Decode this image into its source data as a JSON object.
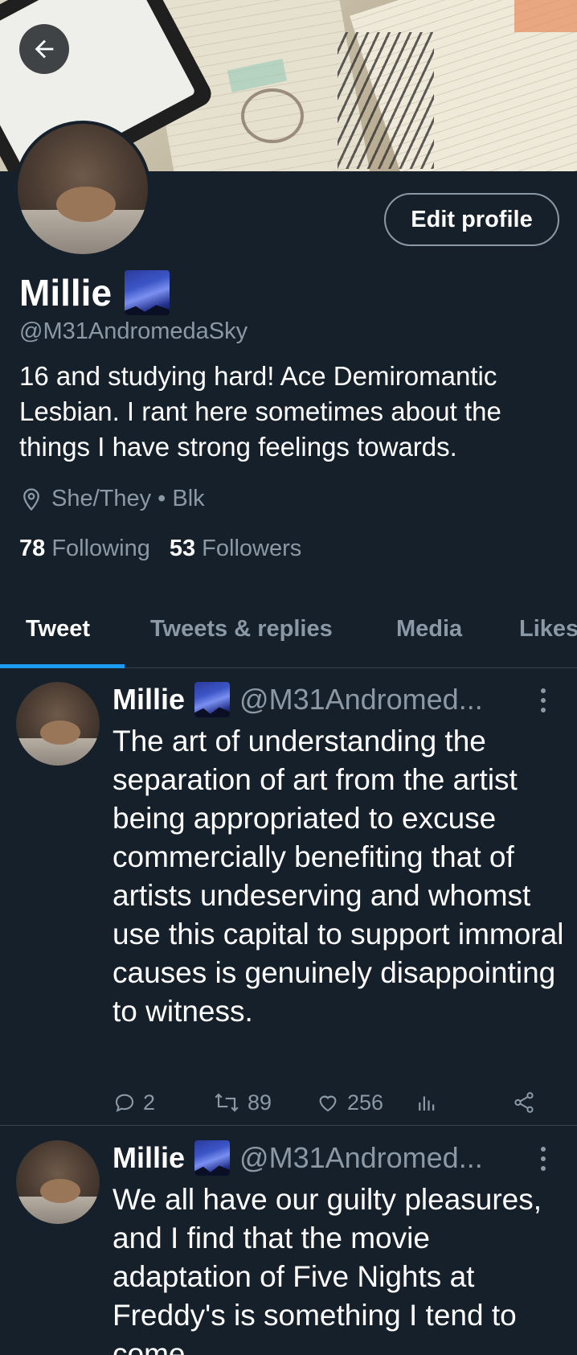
{
  "header": {
    "back_icon": "arrow-left-icon",
    "edit_profile_label": "Edit profile"
  },
  "profile": {
    "name": "Millie",
    "name_emoji": "milky-way-emoji",
    "handle": "@M31AndromedaSky",
    "bio": "16 and studying hard! Ace Demiromantic Lesbian. I rant here sometimes about the things I have strong feelings towards.",
    "location_icon": "location-pin-icon",
    "location": "She/They • Blk",
    "following_count": "78",
    "following_label": "Following",
    "followers_count": "53",
    "followers_label": "Followers"
  },
  "tabs": [
    {
      "label": "Tweet",
      "active": true
    },
    {
      "label": "Tweets & replies",
      "active": false
    },
    {
      "label": "Media",
      "active": false
    },
    {
      "label": "Likes",
      "active": false
    }
  ],
  "tweets": [
    {
      "name": "Millie",
      "handle": "@M31Andromed...",
      "text": "The art of understanding the separation of art from the artist being appropriated to excuse commercially benefiting that of artists undeserving and whomst use this capital to support immoral causes is genuinely disappointing to witness.",
      "replies": "2",
      "retweets": "89",
      "likes": "256"
    },
    {
      "name": "Millie",
      "handle": "@M31Andromed...",
      "text": "We all have our guilty pleasures, and I find that the movie adaptation of Five Nights at Freddy's is something I tend to come"
    }
  ],
  "colors": {
    "background": "#15202b",
    "secondary_text": "#8b98a5",
    "accent": "#1d9bf0",
    "divider": "#38444d"
  }
}
